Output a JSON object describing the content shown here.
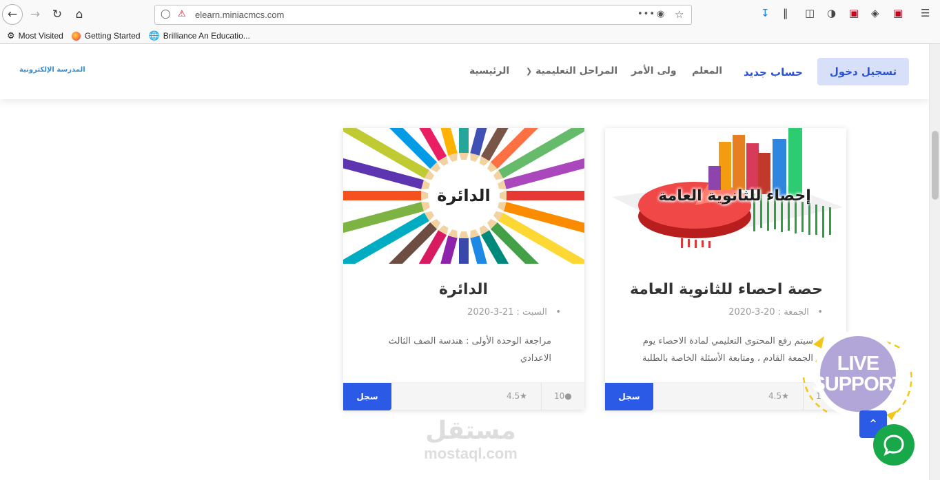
{
  "browser": {
    "url": "elearn.miniacmcs.com",
    "bookmarks": [
      "Most Visited",
      "Getting Started",
      "Brilliance An Educatio..."
    ]
  },
  "header": {
    "logo": "المدرسة الإلكترونية",
    "nav": {
      "home": "الرئيسية",
      "stages": "المراحل التعليمية",
      "guardian": "ولى الأمر",
      "teacher": "المعلم",
      "register": "حساب جديد",
      "login": "تسجيل دخول"
    }
  },
  "cards": [
    {
      "image_caption": "إحصاء للثانوية العامة",
      "title": "حصة احصاء للثانوية العامة",
      "meta": "الجمعة : 20-3-2020",
      "description": "سيتم رفع المحتوى التعليمي لمادة الاحصاء يوم الجمعة القادم ، ومتابعة الأسئلة الخاصة بالطلبة",
      "enroll": "سجل",
      "rating": "4.5",
      "students": "10"
    },
    {
      "image_caption": "الدائرة",
      "title": "الدائرة",
      "meta": "السبت : 21-3-2020",
      "description": "مراجعة الوحدة الأولى : هندسة الصف الثالث الاعدادي",
      "enroll": "سجل",
      "rating": "4.5",
      "students": "10"
    }
  ],
  "widgets": {
    "live_support_line1": "LIVE",
    "live_support_line2": "SUPPORT"
  },
  "watermark": {
    "arabic": "مستقل",
    "latin": "mostaql.com"
  },
  "colors": {
    "primary": "#2b5be6",
    "login_bg": "#d7e0f8",
    "chat": "#19a849",
    "live_support": "#b2a6d8"
  }
}
